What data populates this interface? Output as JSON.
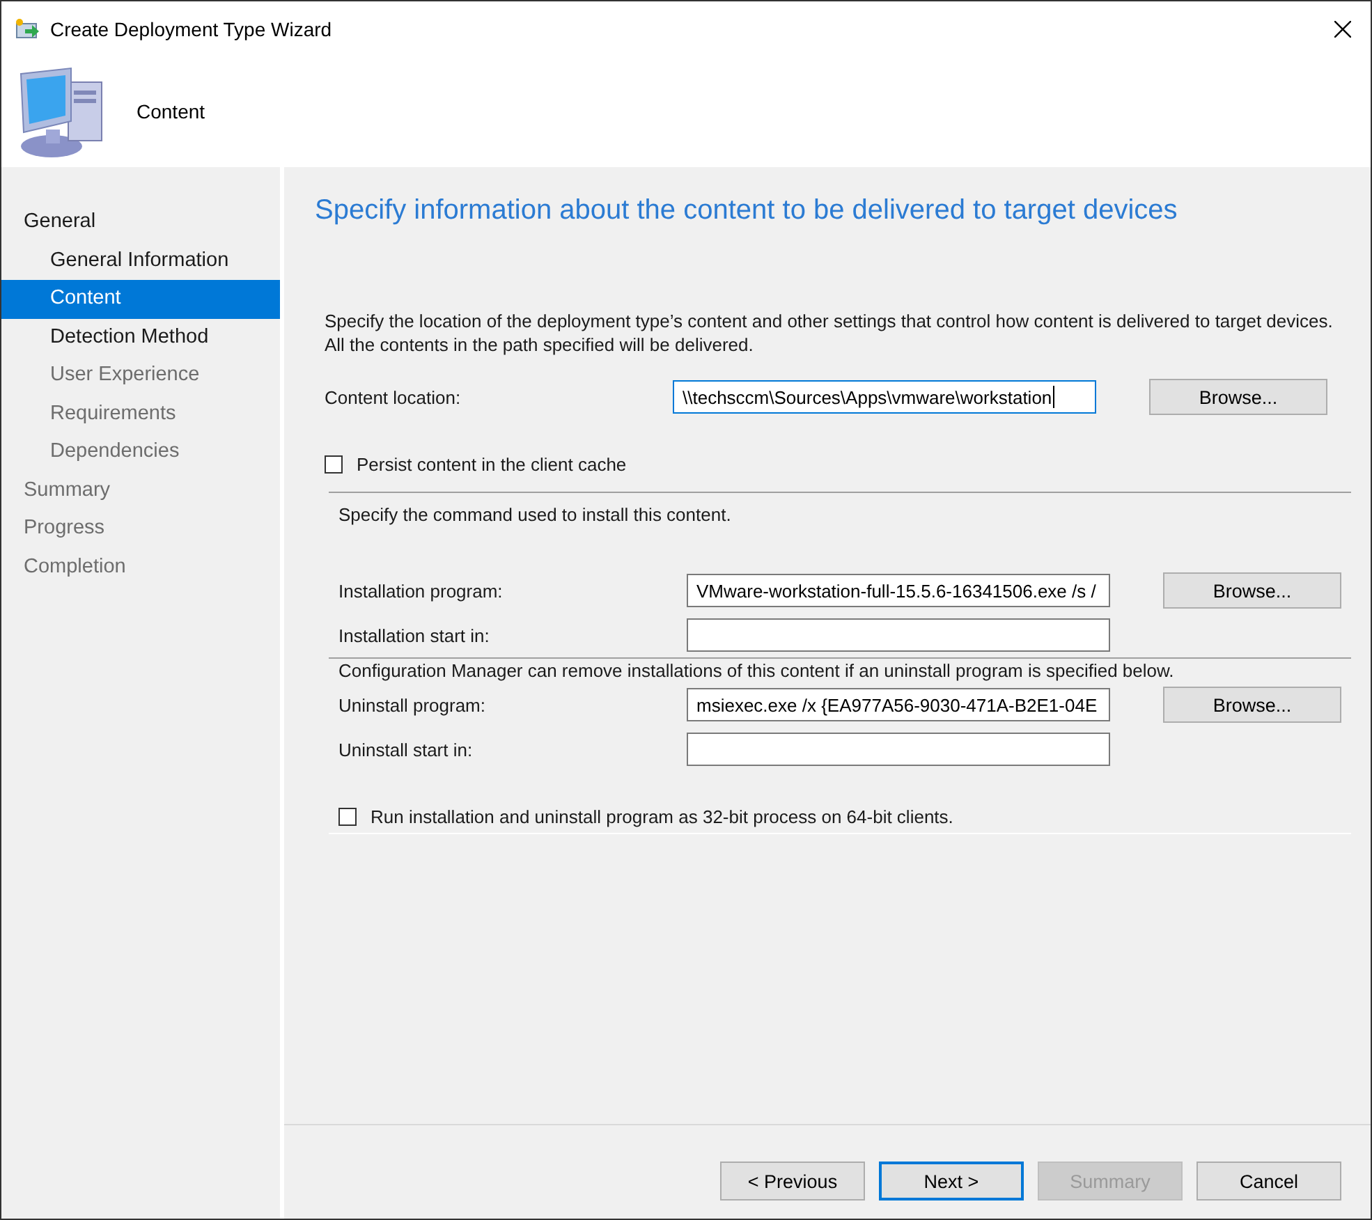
{
  "window": {
    "title": "Create Deployment Type Wizard"
  },
  "header": {
    "title": "Content"
  },
  "nav": [
    {
      "label": "General",
      "disabled": false,
      "selected": false,
      "children": [
        {
          "label": "General Information",
          "disabled": false,
          "selected": false
        },
        {
          "label": "Content",
          "disabled": false,
          "selected": true
        },
        {
          "label": "Detection Method",
          "disabled": false,
          "selected": false
        },
        {
          "label": "User Experience",
          "disabled": true,
          "selected": false
        },
        {
          "label": "Requirements",
          "disabled": true,
          "selected": false
        },
        {
          "label": "Dependencies",
          "disabled": true,
          "selected": false
        }
      ]
    },
    {
      "label": "Summary",
      "disabled": true,
      "selected": false
    },
    {
      "label": "Progress",
      "disabled": true,
      "selected": false
    },
    {
      "label": "Completion",
      "disabled": true,
      "selected": false
    }
  ],
  "page": {
    "heading": "Specify information about the content to be delivered to target devices",
    "sections": [
      {
        "intro": "Specify the location of the deployment type’s content and other settings that control how content is delivered to target devices. All the contents in the path specified will be delivered.",
        "rows": [
          {
            "kind": "field",
            "label": "Content location:",
            "value": "\\\\techsccm\\Sources\\Apps\\vmware\\workstation",
            "focused": true,
            "button": "Browse..."
          },
          {
            "kind": "checkbox",
            "label": "Persist content in the client cache",
            "checked": false
          }
        ]
      },
      {
        "intro": "Specify the command used to install this content.",
        "rows": [
          {
            "kind": "field",
            "label": "Installation program:",
            "value": "VMware-workstation-full-15.5.6-16341506.exe /s /",
            "focused": false,
            "button": "Browse..."
          },
          {
            "kind": "field",
            "label": "Installation start in:",
            "focused": false
          }
        ]
      },
      {
        "intro": "Configuration Manager can remove installations of this content if an uninstall program is specified below.",
        "rows": [
          {
            "kind": "field",
            "label": "Uninstall program:",
            "value": "msiexec.exe /x {EA977A56-9030-471A-B2E1-04E",
            "focused": false,
            "button": "Browse..."
          },
          {
            "kind": "field",
            "label": "Uninstall start in:",
            "focused": false
          },
          {
            "kind": "checkbox",
            "label": "Run installation and uninstall program as 32-bit process on 64-bit clients.",
            "checked": false
          }
        ]
      }
    ]
  },
  "buttons": [
    {
      "label": "< Previous",
      "disabled": false,
      "default": false
    },
    {
      "label": "Next >",
      "disabled": false,
      "default": true
    },
    {
      "label": "Summary",
      "disabled": true,
      "default": false
    },
    {
      "label": "Cancel",
      "disabled": false,
      "default": false
    }
  ]
}
